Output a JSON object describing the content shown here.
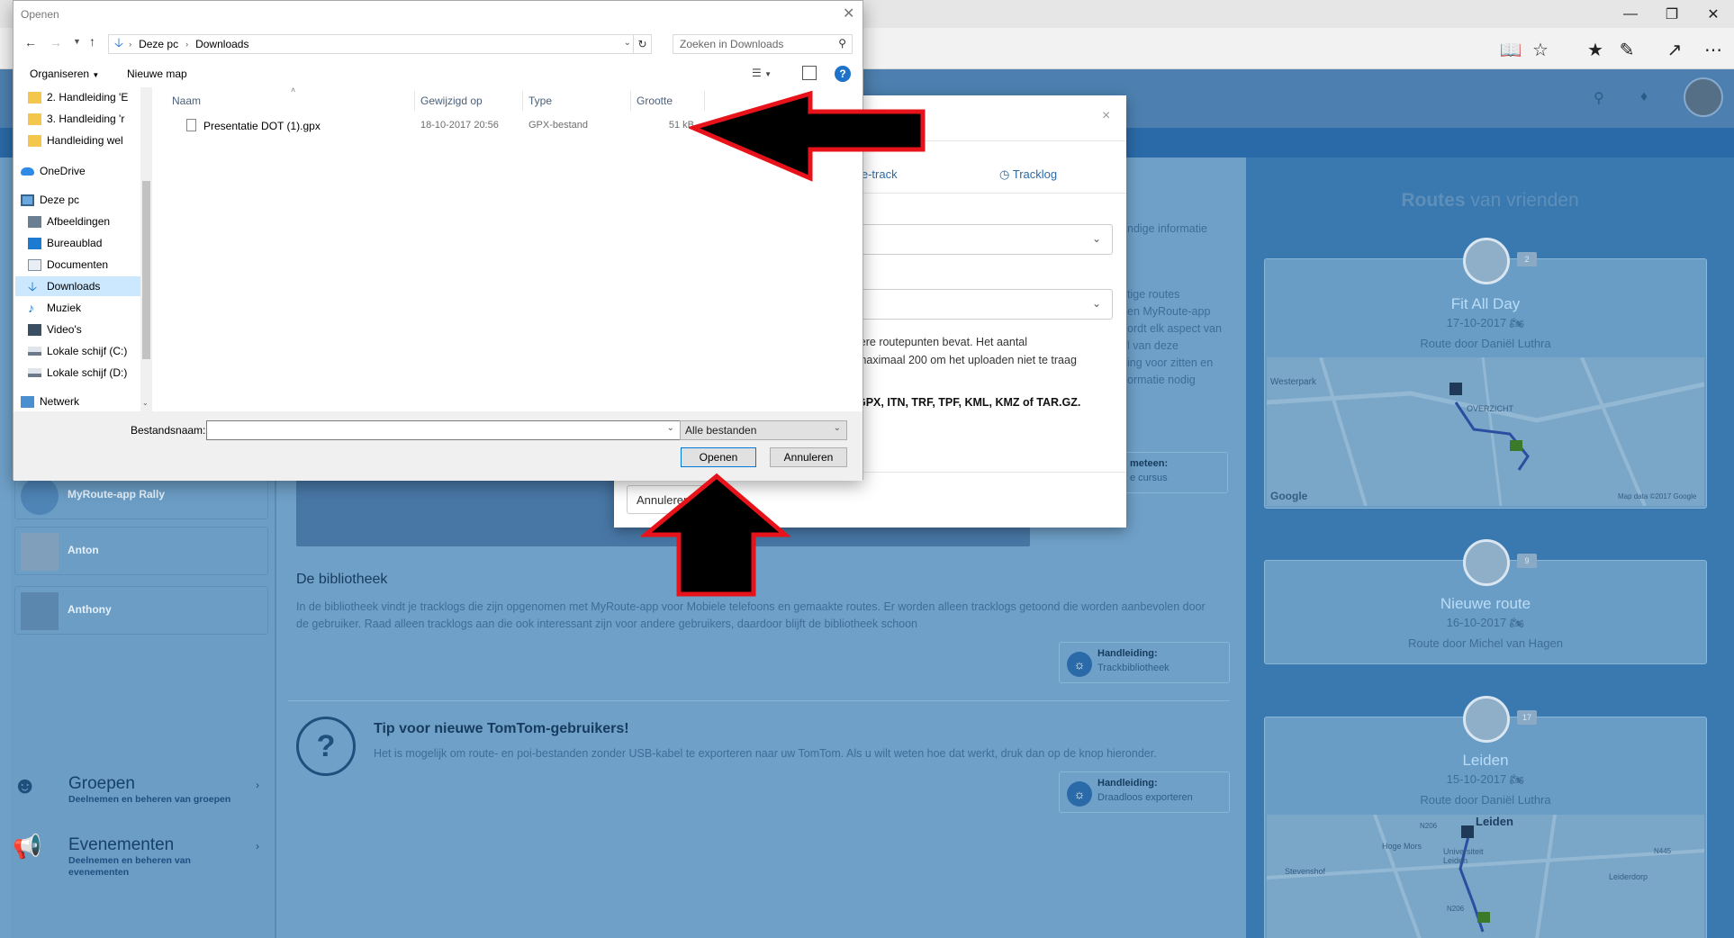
{
  "browser": {
    "reading_view_icon": "book-icon",
    "favorite_icon": "star-icon",
    "hub_icon": "favorites-list-icon",
    "notes_icon": "pen-icon",
    "share_icon": "share-icon",
    "more_icon": "more-icon"
  },
  "site": {
    "routes_title_bold": "Routes",
    "routes_title_rest": "van vrienden",
    "friends": [
      {
        "name": "Fit All Day",
        "date": "17-10-2017",
        "by": "Route door Daniël Luthra",
        "badge": "2"
      },
      {
        "name": "Nieuwe route",
        "date": "16-10-2017",
        "by": "Route door Michel van Hagen",
        "badge": "9"
      },
      {
        "name": "Leiden",
        "date": "15-10-2017",
        "by": "Route door Daniël Luthra",
        "badge": "17"
      }
    ],
    "map1_labels": [
      "Westerpark",
      "OVERZICHT",
      "Google",
      "Map data ©2017 Google"
    ],
    "map2_labels": [
      "Leiden",
      "Hoge Mors",
      "Stevenshof",
      "Universiteit Leiden",
      "Leiderdorp",
      "N206",
      "N445",
      "N206"
    ],
    "people": [
      "MyRoute-app Rally",
      "Anton",
      "Anthony"
    ],
    "menu": [
      {
        "title": "Groepen",
        "sub": "Deelnemen en beheren van groepen"
      },
      {
        "title": "Evenementen",
        "sub": "Deelnemen en beheren van evenementen"
      }
    ],
    "library_title": "De bibliotheek",
    "library_text": "In de bibliotheek vindt je tracklogs die zijn opgenomen met MyRoute-app voor Mobiele telefoons en gemaakte routes. Er worden alleen tracklogs getoond die worden aanbevolen door de gebruiker. Raad alleen tracklogs aan die ook interessant zijn voor andere gebruikers, daardoor blijft de bibliotheek schoon",
    "library_help_title": "Handleiding:",
    "library_help_link": "Trackbibliotheek",
    "tip_title": "Tip voor nieuwe TomTom-gebruikers!",
    "tip_text": "Het is mogelijk om route- en poi-bestanden zonder USB-kabel te exporteren naar uw TomTom. Als u wilt weten hoe dat werkt, druk dan op de knop hieronder.",
    "tip_help_title": "Handleiding:",
    "tip_help_link": "Draadloos exporteren",
    "bg_text_lines": [
      "ndige informatie",
      "tige routes",
      "en MyRoute-app",
      "ordt elk aspect van",
      "l van deze",
      "ing voor zitten en",
      "ormatie nodig"
    ],
    "bg_help_title": "meteen:",
    "bg_help_link": "e cursus"
  },
  "modal": {
    "tab_route": "ute-track",
    "tab_tracklog": "Tracklog",
    "text_line1": "lere routepunten bevat. Het aantal",
    "text_line2": "maximaal 200 om het uploaden niet te traag",
    "formats": "GPX, ITN, TRF, TPF, KML, KMZ of TAR.GZ.",
    "cancel": "Annuleren"
  },
  "dialog": {
    "title": "Openen",
    "breadcrumb": [
      "Deze pc",
      "Downloads"
    ],
    "search_placeholder": "Zoeken in Downloads",
    "organize": "Organiseren",
    "new_folder": "Nieuwe map",
    "nav": [
      {
        "label": "2. Handleiding 'E",
        "icon": "folder-icon"
      },
      {
        "label": "3. Handleiding 'r",
        "icon": "folder-icon"
      },
      {
        "label": "Handleiding wel",
        "icon": "folder-icon"
      },
      {
        "label": "OneDrive",
        "icon": "cloud-icon"
      },
      {
        "label": "Deze pc",
        "icon": "computer-icon"
      },
      {
        "label": "Afbeeldingen",
        "icon": "pictures-icon"
      },
      {
        "label": "Bureaublad",
        "icon": "desktop-icon"
      },
      {
        "label": "Documenten",
        "icon": "documents-icon"
      },
      {
        "label": "Downloads",
        "icon": "downloads-icon"
      },
      {
        "label": "Muziek",
        "icon": "music-icon"
      },
      {
        "label": "Video's",
        "icon": "videos-icon"
      },
      {
        "label": "Lokale schijf (C:)",
        "icon": "drive-icon"
      },
      {
        "label": "Lokale schijf (D:)",
        "icon": "drive-icon"
      },
      {
        "label": "Netwerk",
        "icon": "network-icon"
      }
    ],
    "columns": [
      "Naam",
      "Gewijzigd op",
      "Type",
      "Grootte"
    ],
    "files": [
      {
        "name": "Presentatie DOT (1).gpx",
        "modified": "18-10-2017 20:56",
        "type": "GPX-bestand",
        "size": "51 kB"
      }
    ],
    "filename_label": "Bestandsnaam:",
    "filename_value": "",
    "filter": "Alle bestanden",
    "open": "Openen",
    "cancel": "Annuleren"
  },
  "colors": {
    "arrow_fill": "#000000",
    "arrow_outline": "#e8131a",
    "selection": "#cce8ff",
    "site_blue": "#2a6aa8"
  }
}
